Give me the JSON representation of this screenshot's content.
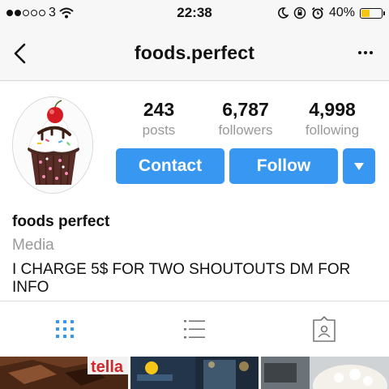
{
  "status_bar": {
    "signal_dots_filled": 2,
    "signal_dots_total": 5,
    "carrier": "3",
    "time": "22:38",
    "battery": "40%",
    "battery_level": 0.4,
    "icons": [
      "signal-dots-icon",
      "wifi-icon",
      "moon-icon",
      "lock-rotation-icon",
      "alarm-icon",
      "battery-icon"
    ]
  },
  "nav": {
    "title": "foods.perfect",
    "back_icon": "back-chevron-icon",
    "more_icon": "more-dots-icon"
  },
  "profile": {
    "avatar": "cupcake-avatar",
    "stats": [
      {
        "count": "243",
        "label": "posts"
      },
      {
        "count": "6,787",
        "label": "followers"
      },
      {
        "count": "4,998",
        "label": "following"
      }
    ],
    "buttons": {
      "contact": "Contact",
      "follow": "Follow",
      "dropdown_icon": "caret-down-icon"
    },
    "name": "foods perfect",
    "category": "Media",
    "bio": "I CHARGE 5$ FOR TWO SHOUTOUTS DM FOR INFO"
  },
  "tabs": [
    {
      "icon": "grid-icon",
      "active": true
    },
    {
      "icon": "list-icon",
      "active": false
    },
    {
      "icon": "tagged-icon",
      "active": false
    }
  ],
  "colors": {
    "accent": "#3897f0",
    "muted_text": "#999999",
    "battery_fill": "#f5c518"
  }
}
